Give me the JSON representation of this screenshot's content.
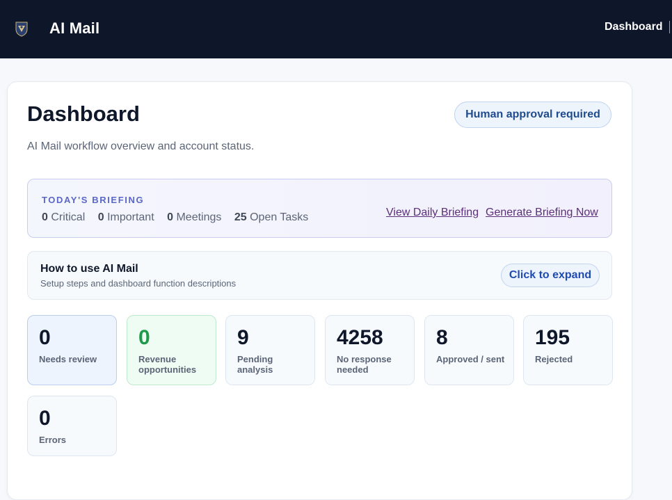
{
  "header": {
    "app_title": "AI Mail",
    "nav": {
      "dashboard": "Dashboard"
    }
  },
  "page": {
    "title": "Dashboard",
    "subtitle": "AI Mail workflow overview and account status.",
    "approval_badge": "Human approval required"
  },
  "briefing": {
    "heading": "TODAY'S BRIEFING",
    "stats": [
      {
        "value": "0",
        "label": "Critical"
      },
      {
        "value": "0",
        "label": "Important"
      },
      {
        "value": "0",
        "label": "Meetings"
      },
      {
        "value": "25",
        "label": "Open Tasks"
      }
    ],
    "view_link": "View Daily Briefing",
    "generate_link": "Generate Briefing Now"
  },
  "howto": {
    "title": "How to use AI Mail",
    "subtitle": "Setup steps and dashboard function descriptions",
    "expand_label": "Click to expand"
  },
  "stats": [
    {
      "value": "0",
      "label": "Needs review"
    },
    {
      "value": "0",
      "label": "Revenue opportunities"
    },
    {
      "value": "9",
      "label": "Pending analysis"
    },
    {
      "value": "4258",
      "label": "No response needed"
    },
    {
      "value": "8",
      "label": "Approved / sent"
    },
    {
      "value": "195",
      "label": "Rejected"
    },
    {
      "value": "0",
      "label": "Errors"
    }
  ],
  "colors": {
    "topbar": "#0e1629",
    "accent_blue": "#1f4bb0",
    "briefing_accent": "#5a67c9",
    "revenue_green": "#1f9a4a",
    "link_purple": "#5b2f7a"
  },
  "icons": {
    "logo": "crest-logo-icon"
  }
}
